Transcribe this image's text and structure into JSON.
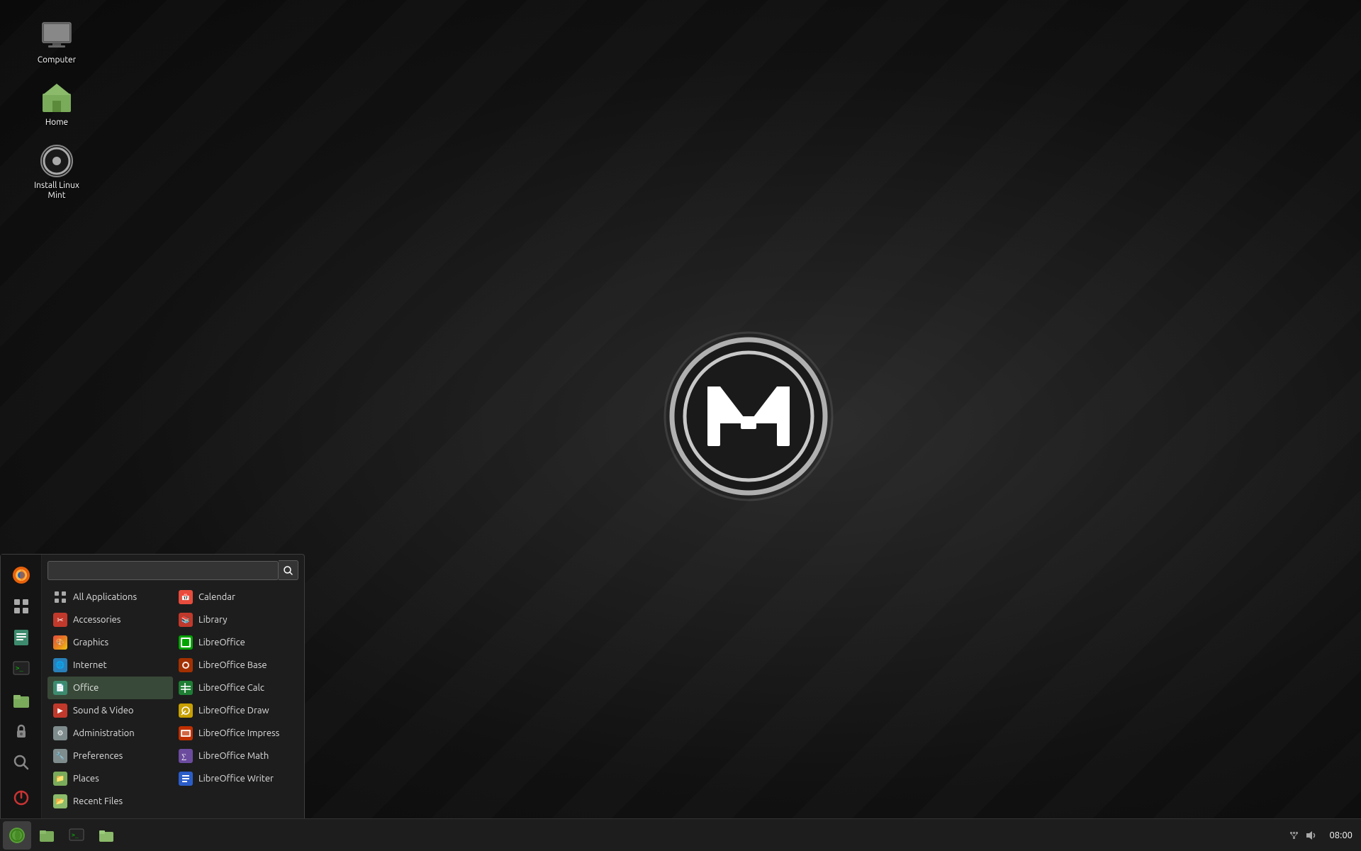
{
  "desktop": {
    "background": "#1a1a1a"
  },
  "desktop_icons": [
    {
      "id": "computer",
      "label": "Computer",
      "icon": "computer"
    },
    {
      "id": "home",
      "label": "Home",
      "icon": "home"
    },
    {
      "id": "install",
      "label": "Install Linux Mint",
      "icon": "install"
    }
  ],
  "taskbar": {
    "time": "08:00",
    "buttons": [
      {
        "id": "menu",
        "icon": "🌿",
        "active": true
      },
      {
        "id": "files",
        "icon": "📁",
        "active": false
      },
      {
        "id": "terminal",
        "icon": "⬛",
        "active": false
      },
      {
        "id": "folder",
        "icon": "📂",
        "active": false
      }
    ]
  },
  "start_menu": {
    "search_placeholder": "",
    "sidebar_icons": [
      {
        "id": "firefox",
        "icon": "🦊"
      },
      {
        "id": "grid",
        "icon": "⊞"
      },
      {
        "id": "notes",
        "icon": "📋"
      },
      {
        "id": "terminal2",
        "icon": "⬛"
      },
      {
        "id": "files2",
        "icon": "📁"
      },
      {
        "id": "lock",
        "icon": "🔒"
      },
      {
        "id": "search2",
        "icon": "🔍"
      },
      {
        "id": "power",
        "icon": "⏻"
      }
    ],
    "left_column": [
      {
        "id": "all-applications",
        "label": "All Applications",
        "icon_type": "grid",
        "selected": false
      },
      {
        "id": "accessories",
        "label": "Accessories",
        "icon_type": "acc",
        "selected": false
      },
      {
        "id": "graphics",
        "label": "Graphics",
        "icon_type": "gfx",
        "selected": false
      },
      {
        "id": "internet",
        "label": "Internet",
        "icon_type": "net",
        "selected": false
      },
      {
        "id": "office",
        "label": "Office",
        "icon_type": "off",
        "selected": true
      },
      {
        "id": "sound-video",
        "label": "Sound & Video",
        "icon_type": "snd",
        "selected": false
      },
      {
        "id": "administration",
        "label": "Administration",
        "icon_type": "adm",
        "selected": false
      },
      {
        "id": "preferences",
        "label": "Preferences",
        "icon_type": "pref",
        "selected": false
      },
      {
        "id": "places",
        "label": "Places",
        "icon_type": "place",
        "selected": false
      },
      {
        "id": "recent-files",
        "label": "Recent Files",
        "icon_type": "recent",
        "selected": false
      }
    ],
    "right_column": [
      {
        "id": "calendar",
        "label": "Calendar",
        "icon_type": "cal"
      },
      {
        "id": "library",
        "label": "Library",
        "icon_type": "lib"
      },
      {
        "id": "libreoffice",
        "label": "LibreOffice",
        "icon_type": "lo"
      },
      {
        "id": "libreoffice-base",
        "label": "LibreOffice Base",
        "icon_type": "lob"
      },
      {
        "id": "libreoffice-calc",
        "label": "LibreOffice Calc",
        "icon_type": "loc"
      },
      {
        "id": "libreoffice-draw",
        "label": "LibreOffice Draw",
        "icon_type": "lod"
      },
      {
        "id": "libreoffice-impress",
        "label": "LibreOffice Impress",
        "icon_type": "loi"
      },
      {
        "id": "libreoffice-math",
        "label": "LibreOffice Math",
        "icon_type": "lom"
      },
      {
        "id": "libreoffice-writer",
        "label": "LibreOffice Writer",
        "icon_type": "low"
      }
    ]
  }
}
